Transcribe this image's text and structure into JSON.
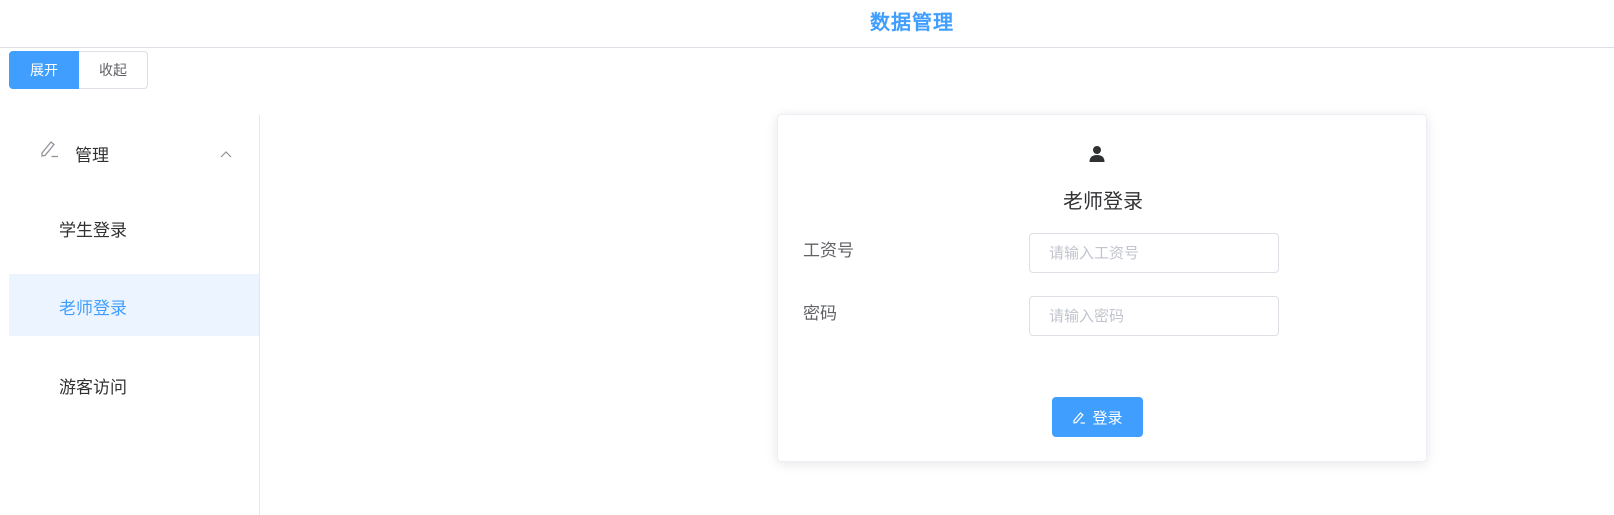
{
  "header": {
    "title": "数据管理"
  },
  "toggle": {
    "expand_label": "展开",
    "collapse_label": "收起"
  },
  "sidebar": {
    "group_label": "管理",
    "group_icon": "edit-icon",
    "items": [
      {
        "label": "学生登录",
        "active": false
      },
      {
        "label": "老师登录",
        "active": true
      },
      {
        "label": "游客访问",
        "active": false
      }
    ]
  },
  "login_card": {
    "icon": "user-icon",
    "title": "老师登录",
    "fields": [
      {
        "label": "工资号",
        "value": "",
        "placeholder": "请输入工资号"
      },
      {
        "label": "密码",
        "value": "",
        "placeholder": "请输入密码"
      }
    ],
    "submit_label": "登录",
    "submit_icon": "edit-icon"
  },
  "colors": {
    "accent": "#409eff",
    "active_bg": "#ecf5ff",
    "border": "#dcdfe6"
  }
}
